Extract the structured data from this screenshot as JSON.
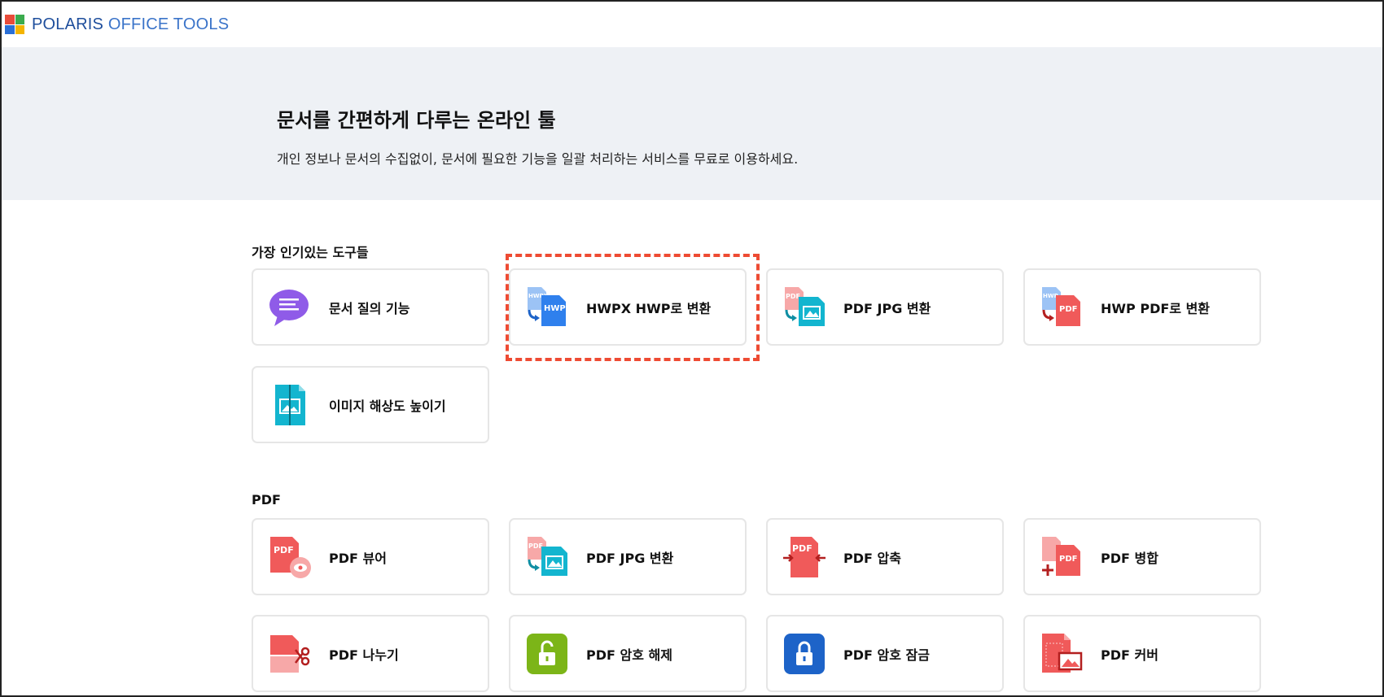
{
  "app": {
    "logo_text_bold": "POLARIS",
    "logo_text_light": "OFFICE TOOLS"
  },
  "hero": {
    "title": "문서를 간편하게 다루는 온라인 툴",
    "subtitle": "개인 정보나 문서의 수집없이, 문서에 필요한 기능을 일괄 처리하는 서비스를 무료로 이용하세요."
  },
  "sections": {
    "popular": {
      "title": "가장 인기있는 도구들",
      "items": [
        {
          "label": "문서 질의 기능",
          "icon": "chat-bubble-icon"
        },
        {
          "label": "HWPX HWP로 변환",
          "icon": "hwpx-to-hwp-icon"
        },
        {
          "label": "PDF JPG 변환",
          "icon": "pdf-to-jpg-icon"
        },
        {
          "label": "HWP PDF로 변환",
          "icon": "hwp-to-pdf-icon"
        },
        {
          "label": "이미지 해상도 높이기",
          "icon": "image-upscale-icon"
        }
      ]
    },
    "pdf": {
      "title": "PDF",
      "items": [
        {
          "label": "PDF 뷰어",
          "icon": "pdf-viewer-icon"
        },
        {
          "label": "PDF JPG 변환",
          "icon": "pdf-to-jpg-icon"
        },
        {
          "label": "PDF 압축",
          "icon": "pdf-compress-icon"
        },
        {
          "label": "PDF 병합",
          "icon": "pdf-merge-icon"
        },
        {
          "label": "PDF 나누기",
          "icon": "pdf-split-icon"
        },
        {
          "label": "PDF 암호 해제",
          "icon": "pdf-unlock-icon"
        },
        {
          "label": "PDF 암호 잠금",
          "icon": "pdf-lock-icon"
        },
        {
          "label": "PDF 커버",
          "icon": "pdf-cover-icon"
        }
      ]
    }
  },
  "icon_text": {
    "pdf": "PDF",
    "hwp": "HWP",
    "hwp_small": "HWP",
    "hwpx_small": "HWPX"
  },
  "colors": {
    "pdf_red": "#f05a5a",
    "pdf_red_light": "#f7a8a8",
    "hwp_blue": "#2f80ed",
    "hwp_blue_light": "#9cc3f5",
    "image_teal": "#13b5cf",
    "chat_purple": "#8f5be8",
    "unlock_green": "#7cb518",
    "lock_blue": "#1d63c8",
    "highlight_red": "#ee4b33",
    "hero_bg": "#eef1f5"
  }
}
